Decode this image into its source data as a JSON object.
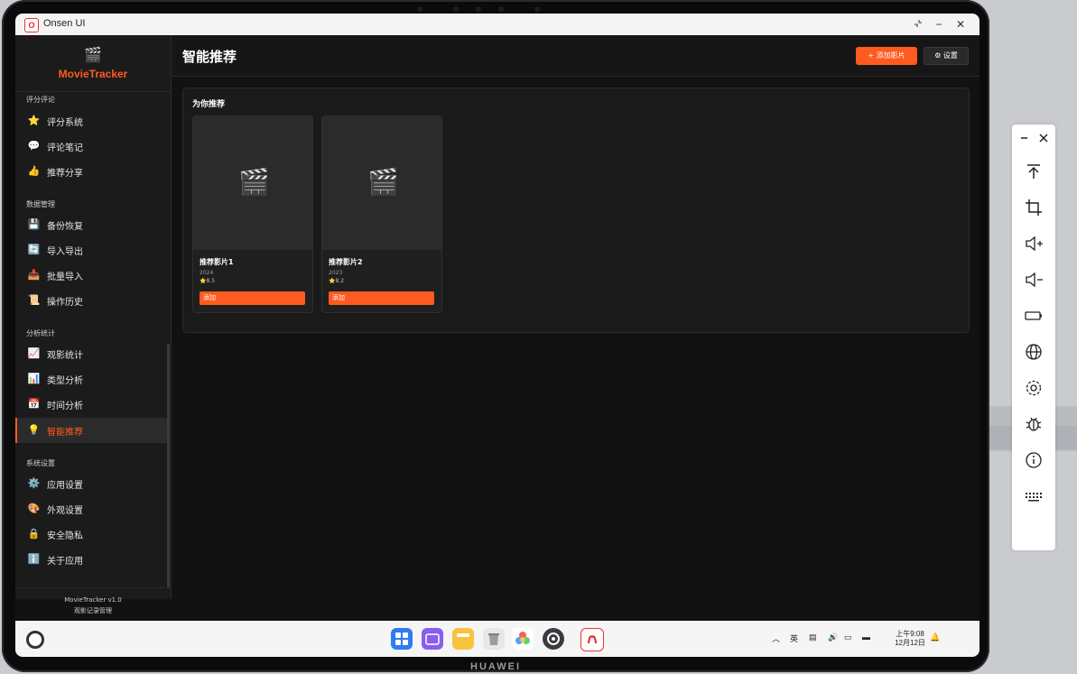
{
  "window": {
    "title": "Onsen UI",
    "app_icon_text": "O"
  },
  "sidebar": {
    "logo_icon": "🎬",
    "logo_text": "MovieTracker",
    "sections": [
      {
        "label": "评分评论",
        "items": [
          {
            "icon": "⭐",
            "label": "评分系统"
          },
          {
            "icon": "💬",
            "label": "评论笔记"
          },
          {
            "icon": "👍",
            "label": "推荐分享"
          }
        ]
      },
      {
        "label": "数据管理",
        "items": [
          {
            "icon": "💾",
            "label": "备份恢复"
          },
          {
            "icon": "🔄",
            "label": "导入导出"
          },
          {
            "icon": "📥",
            "label": "批量导入"
          },
          {
            "icon": "📜",
            "label": "操作历史"
          }
        ]
      },
      {
        "label": "分析统计",
        "items": [
          {
            "icon": "📈",
            "label": "观影统计"
          },
          {
            "icon": "📊",
            "label": "类型分析"
          },
          {
            "icon": "📅",
            "label": "时间分析"
          },
          {
            "icon": "💡",
            "label": "智能推荐"
          }
        ]
      },
      {
        "label": "系统设置",
        "items": [
          {
            "icon": "⚙️",
            "label": "应用设置"
          },
          {
            "icon": "🎨",
            "label": "外观设置"
          },
          {
            "icon": "🔒",
            "label": "安全隐私"
          },
          {
            "icon": "ℹ️",
            "label": "关于应用"
          }
        ]
      }
    ],
    "active_item": "智能推荐",
    "footer": {
      "version": "MovieTracker v1.0",
      "tagline": "观影记录管理"
    }
  },
  "main": {
    "title": "智能推荐",
    "add_button": "+ 添加影片",
    "settings_button": "⚙ 设置",
    "panel_title": "为你推荐",
    "cards": [
      {
        "title": "推荐影片1",
        "year": "2024",
        "rating": "⭐8.5",
        "button": "添加",
        "poster_icon": "🎬"
      },
      {
        "title": "推荐影片2",
        "year": "2023",
        "rating": "⭐8.2",
        "button": "添加",
        "poster_icon": "🎬"
      }
    ]
  },
  "taskbar": {
    "tray_lang": "英",
    "clock": {
      "time": "上午9:08",
      "date": "12月12日"
    }
  },
  "device": {
    "brand": "HUAWEI"
  },
  "colors": {
    "accent": "#ff5a1f",
    "background": "#121212",
    "sidebar": "#1b1b1b"
  }
}
